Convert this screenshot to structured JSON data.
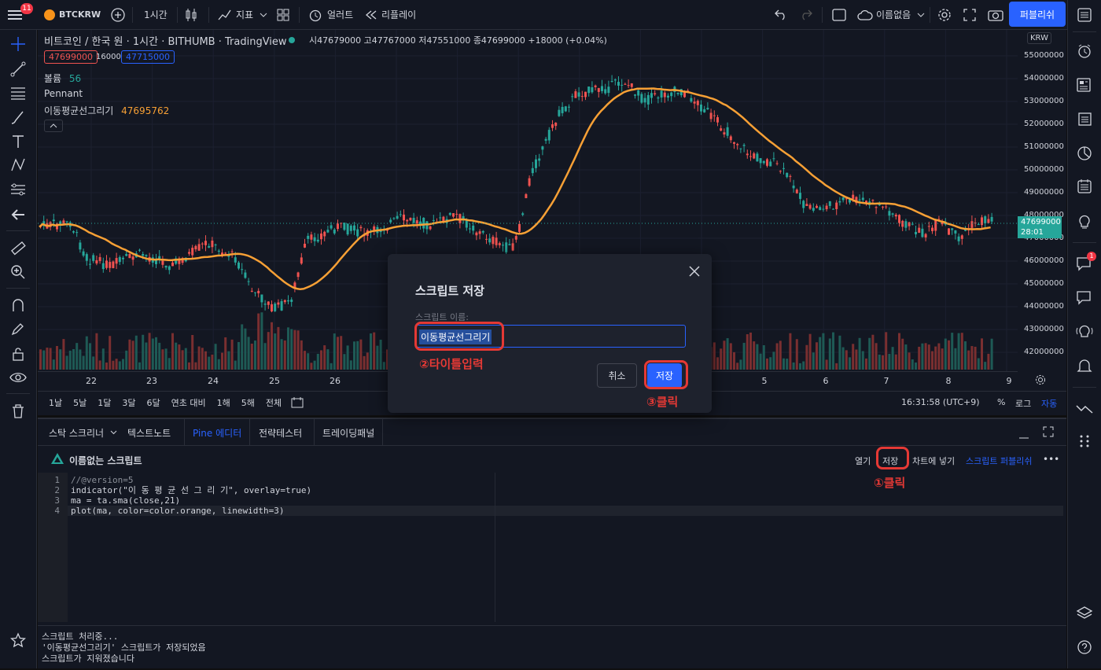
{
  "topbar": {
    "notif_count": "11",
    "symbol": "BTCKRW",
    "interval": "1시간",
    "indicators": "지표",
    "alert": "얼러트",
    "replay": "리플레이",
    "layout_name": "이름없음",
    "publish": "퍼블리쉬"
  },
  "chart": {
    "title": "비트코인 / 한국 원 · 1시간 · BITHUMB · TradingView",
    "ohlc": "시47679000 고47767000 저47551000 종47699000 +18000 (+0.04%)",
    "sell_price": "47699000",
    "spread": "16000",
    "buy_price": "47715000",
    "volume_label": "볼륨",
    "volume_value": "56",
    "pattern": "Pennant",
    "ma_label": "이동평균선그리기",
    "ma_value": "47695762",
    "currency": "KRW",
    "last_price": "47699000",
    "countdown": "28:01",
    "price_ticks": [
      "55000000",
      "54000000",
      "53000000",
      "52000000",
      "51000000",
      "50000000",
      "49000000",
      "48000000",
      "47000000",
      "46000000",
      "45000000",
      "44000000",
      "43000000",
      "42000000"
    ],
    "date_ticks": [
      "22",
      "23",
      "24",
      "25",
      "26",
      "5",
      "6",
      "7",
      "8",
      "9"
    ],
    "colors": {
      "up": "#26a69a",
      "down": "#ef5350",
      "ma": "#f7a035",
      "accent": "#2962ff"
    }
  },
  "bottombar": {
    "ranges": [
      "1날",
      "5날",
      "1달",
      "3달",
      "6달",
      "연초 대비",
      "1해",
      "5해",
      "전체"
    ],
    "clock": "16:31:58 (UTC+9)",
    "percent": "%",
    "log": "로그",
    "auto": "자동"
  },
  "pine": {
    "tabs": [
      "스탁 스크리너",
      "텍스트노트",
      "Pine 에디터",
      "전략테스터",
      "트레이딩패널"
    ],
    "script_name": "이름없는 스크립트",
    "open": "열기",
    "save": "저장",
    "add_to_chart": "차트에 넣기",
    "publish_script": "스크립트 퍼블리쉬",
    "line_numbers": [
      "1",
      "2",
      "3",
      "4"
    ],
    "code_lines": [
      "//@version=5",
      "indicator(\"이 동 평 균 선 그 리 기\", overlay=true)",
      "ma = ta.sma(close,21)",
      "plot(ma, color=color.orange, linewidth=3)"
    ],
    "console": [
      "스크립트 처리중...",
      "'이동평균선그리기' 스크립트가 저장되었음",
      "스크립트가 지워졌습니다"
    ]
  },
  "modal": {
    "title": "스크립트 저장",
    "field_label": "스크립트 이름:",
    "field_value": "이동평균선그리기",
    "cancel": "취소",
    "save": "저장"
  },
  "annotations": {
    "step1": "①클릭",
    "step2": "②타이틀입력",
    "step3": "③클릭"
  }
}
